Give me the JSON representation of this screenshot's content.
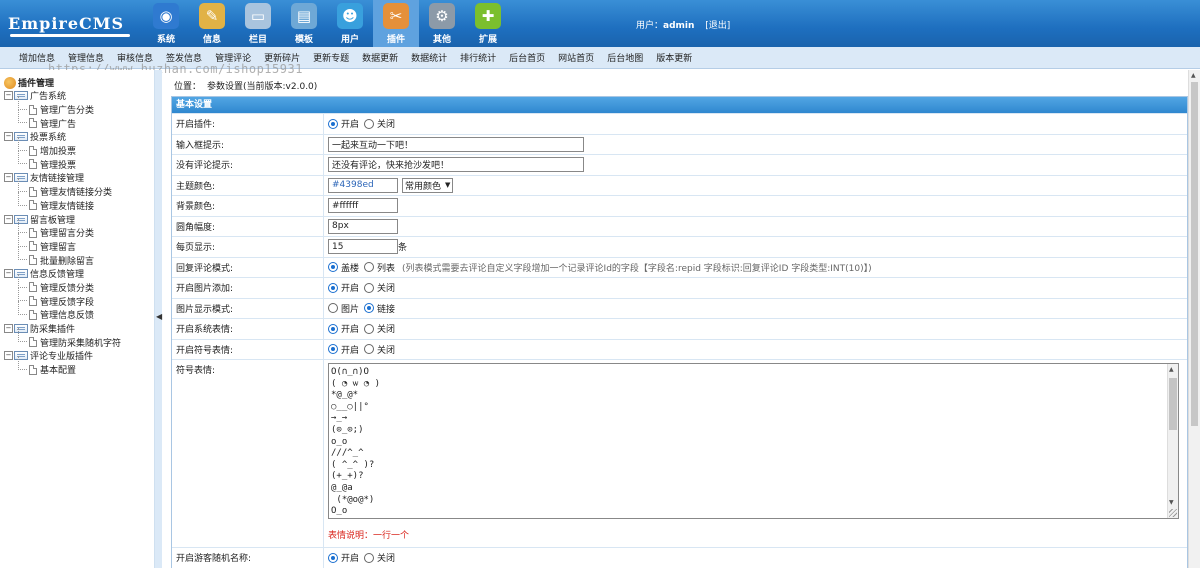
{
  "header": {
    "logo": "EmpireCMS",
    "nav": [
      {
        "label": "系统",
        "icon": "globe-icon",
        "color": "#2f7ad0",
        "glyph": "◉"
      },
      {
        "label": "信息",
        "icon": "notepad-icon",
        "color": "#e1b246",
        "glyph": "✎"
      },
      {
        "label": "栏目",
        "icon": "folder-icon",
        "color": "#a9c4de",
        "glyph": "▭"
      },
      {
        "label": "模板",
        "icon": "window-icon",
        "color": "#6ea8d6",
        "glyph": "▤"
      },
      {
        "label": "用户",
        "icon": "user-icon",
        "color": "#39a0dd",
        "glyph": "☻"
      },
      {
        "label": "插件",
        "icon": "tools-icon",
        "color": "#e5903a",
        "glyph": "✂"
      },
      {
        "label": "其他",
        "icon": "gear-icon",
        "color": "#8c9aa8",
        "glyph": "⚙"
      },
      {
        "label": "扩展",
        "icon": "plus-circle-icon",
        "color": "#7bbf2e",
        "glyph": "✚"
      }
    ],
    "active_index": 5,
    "user_label": "用户：",
    "username": "admin",
    "logout": "[退出]"
  },
  "submenu": [
    "增加信息",
    "管理信息",
    "审核信息",
    "签发信息",
    "管理评论",
    "更新碎片",
    "更新专题",
    "数据更新",
    "数据统计",
    "排行统计",
    "后台首页",
    "网站首页",
    "后台地图",
    "版本更新"
  ],
  "watermark": "https://www.huzhan.com/ishop15931",
  "sidebar": {
    "title": "插件管理",
    "groups": [
      {
        "label": "广告系统",
        "children": [
          "管理广告分类",
          "管理广告"
        ]
      },
      {
        "label": "投票系统",
        "children": [
          "增加投票",
          "管理投票"
        ]
      },
      {
        "label": "友情链接管理",
        "children": [
          "管理友情链接分类",
          "管理友情链接"
        ]
      },
      {
        "label": "留言板管理",
        "children": [
          "管理留言分类",
          "管理留言",
          "批量删除留言"
        ]
      },
      {
        "label": "信息反馈管理",
        "children": [
          "管理反馈分类",
          "管理反馈字段",
          "管理信息反馈"
        ]
      },
      {
        "label": "防采集插件",
        "children": [
          "管理防采集随机字符"
        ]
      },
      {
        "label": "评论专业版插件",
        "children": [
          "基本配置"
        ]
      }
    ]
  },
  "main": {
    "breadcrumb_label": "位置：",
    "breadcrumb": "参数设置(当前版本:v2.0.0)",
    "panel_title": "基本设置",
    "rows": {
      "enable_plugin": {
        "label": "开启插件:",
        "opt1": "开启",
        "opt2": "关闭",
        "selected": 1
      },
      "input_hint": {
        "label": "输入框提示:",
        "value": "一起来互动一下吧！"
      },
      "no_comment_hint": {
        "label": "没有评论提示:",
        "value": "还没有评论，快来抢沙发吧！"
      },
      "theme_color": {
        "label": "主题颜色:",
        "value": "#4398ed",
        "select": "常用颜色"
      },
      "bg_color": {
        "label": "背景颜色:",
        "value": "#ffffff"
      },
      "radius": {
        "label": "圆角幅度:",
        "value": "8px"
      },
      "per_page": {
        "label": "每页显示:",
        "value": "15",
        "unit": "条"
      },
      "reply_mode": {
        "label": "回复评论模式:",
        "opt1": "盖楼",
        "opt2": "列表",
        "selected": 1,
        "hint": "(列表模式需要去评论自定义字段增加一个记录评论Id的字段【字段名:repid 字段标识:回复评论ID 字段类型:INT(10)】)"
      },
      "image_add": {
        "label": "开启图片添加:",
        "opt1": "开启",
        "opt2": "关闭",
        "selected": 1
      },
      "image_mode": {
        "label": "图片显示模式:",
        "opt1": "图片",
        "opt2": "链接",
        "selected": 2
      },
      "system_emote": {
        "label": "开启系统表情:",
        "opt1": "开启",
        "opt2": "关闭",
        "selected": 1
      },
      "symbol_emote": {
        "label": "开启符号表情:",
        "opt1": "开启",
        "opt2": "关闭",
        "selected": 1
      },
      "symbol_list": {
        "label": "符号表情:",
        "value": "O(∩_∩)O\n( ◔ ѡ ◔ )\n*@_@*\n○__○||°\n→_→\n(⊙_⊙;)\no_o\n///^_^\n( ^_^ )?\n(+_+)?\n@_@a\n (*@o@*)\nO_o",
        "note": "表情说明：一行一个"
      },
      "guest_name": {
        "label": "开启游客随机名称:",
        "opt1": "开启",
        "opt2": "关闭",
        "selected": 1
      }
    }
  }
}
